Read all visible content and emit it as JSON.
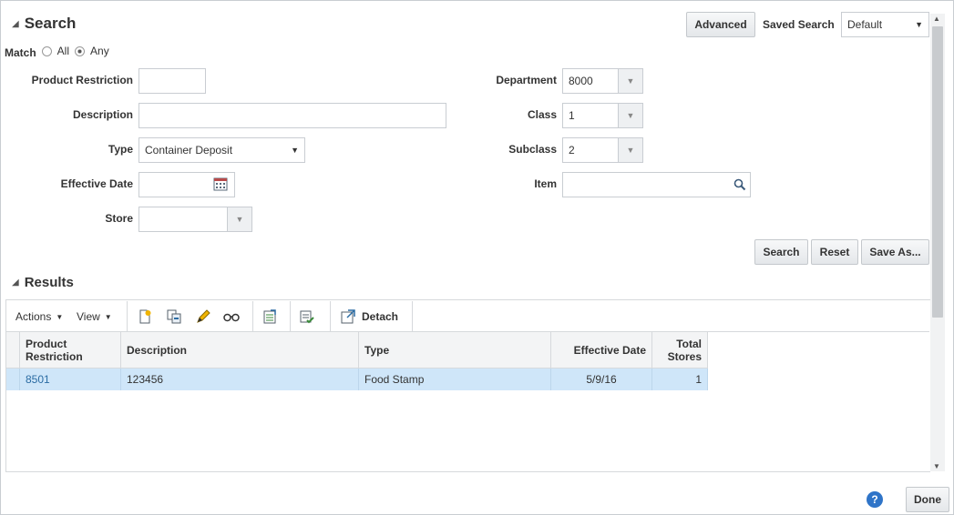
{
  "search": {
    "title": "Search",
    "match_label": "Match",
    "match_all": "All",
    "match_any": "Any",
    "advanced_label": "Advanced",
    "saved_search_label": "Saved Search",
    "saved_search_value": "Default",
    "fields": {
      "product_restriction": {
        "label": "Product Restriction",
        "value": ""
      },
      "description": {
        "label": "Description",
        "value": ""
      },
      "type": {
        "label": "Type",
        "value": "Container Deposit"
      },
      "effective_date": {
        "label": "Effective Date",
        "value": ""
      },
      "store": {
        "label": "Store",
        "value": ""
      },
      "department": {
        "label": "Department",
        "value": "8000"
      },
      "class": {
        "label": "Class",
        "value": "1"
      },
      "subclass": {
        "label": "Subclass",
        "value": "2"
      },
      "item": {
        "label": "Item",
        "value": ""
      }
    },
    "buttons": {
      "search": "Search",
      "reset": "Reset",
      "save_as": "Save As..."
    }
  },
  "results": {
    "title": "Results",
    "toolbar": {
      "actions": "Actions",
      "view": "View",
      "detach": "Detach"
    },
    "columns": {
      "product_restriction": [
        "Product",
        "Restriction"
      ],
      "description": "Description",
      "type": "Type",
      "effective_date": "Effective Date",
      "total_stores": [
        "Total",
        "Stores"
      ]
    },
    "rows": [
      {
        "product_restriction": "8501",
        "description": "123456",
        "type": "Food Stamp",
        "effective_date": "5/9/16",
        "total_stores": "1"
      }
    ]
  },
  "footer": {
    "done": "Done",
    "help": "?"
  },
  "colors": {
    "link": "#2b6ca3",
    "selected_row": "#cfe6f9",
    "help_blue": "#2f74c8"
  }
}
